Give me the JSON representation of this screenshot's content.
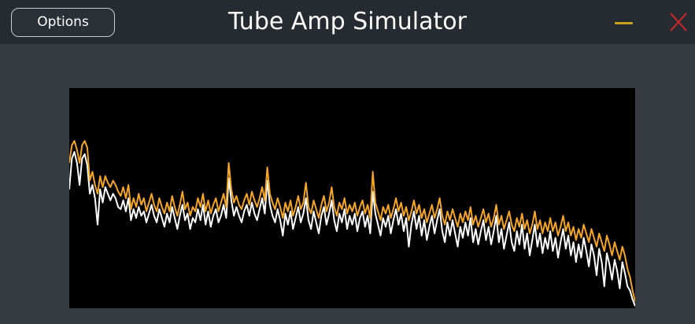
{
  "window": {
    "title": "Tube Amp Simulator",
    "options_label": "Options",
    "minimize_icon": "minimize-icon",
    "close_icon": "close-icon"
  },
  "colors": {
    "background": "#363b42",
    "titlebar": "#262b31",
    "display_background": "#000000",
    "spectrum_primary": "#f5a623",
    "spectrum_secondary": "#ffffff",
    "minimize": "#c9a21d",
    "close": "#c0282d"
  },
  "spectrum": {
    "series": [
      {
        "color": "#f5a623",
        "values": [
          0.66,
          0.74,
          0.76,
          0.72,
          0.66,
          0.74,
          0.76,
          0.73,
          0.58,
          0.62,
          0.56,
          0.52,
          0.6,
          0.55,
          0.6,
          0.57,
          0.55,
          0.58,
          0.56,
          0.53,
          0.51,
          0.55,
          0.5,
          0.56,
          0.45,
          0.5,
          0.46,
          0.52,
          0.47,
          0.5,
          0.44,
          0.48,
          0.52,
          0.47,
          0.44,
          0.5,
          0.46,
          0.43,
          0.48,
          0.44,
          0.51,
          0.46,
          0.42,
          0.47,
          0.53,
          0.45,
          0.48,
          0.42,
          0.46,
          0.44,
          0.5,
          0.46,
          0.52,
          0.44,
          0.49,
          0.43,
          0.47,
          0.5,
          0.44,
          0.48,
          0.52,
          0.46,
          0.66,
          0.54,
          0.48,
          0.51,
          0.47,
          0.45,
          0.49,
          0.52,
          0.47,
          0.53,
          0.49,
          0.46,
          0.5,
          0.55,
          0.49,
          0.64,
          0.52,
          0.48,
          0.45,
          0.5,
          0.46,
          0.41,
          0.48,
          0.44,
          0.49,
          0.42,
          0.46,
          0.51,
          0.45,
          0.48,
          0.57,
          0.46,
          0.43,
          0.49,
          0.45,
          0.41,
          0.47,
          0.51,
          0.44,
          0.48,
          0.55,
          0.46,
          0.42,
          0.48,
          0.45,
          0.5,
          0.43,
          0.47,
          0.44,
          0.48,
          0.42,
          0.46,
          0.49,
          0.43,
          0.47,
          0.41,
          0.62,
          0.48,
          0.44,
          0.4,
          0.46,
          0.43,
          0.47,
          0.41,
          0.45,
          0.5,
          0.44,
          0.48,
          0.42,
          0.46,
          0.4,
          0.44,
          0.49,
          0.43,
          0.47,
          0.41,
          0.45,
          0.39,
          0.43,
          0.47,
          0.41,
          0.45,
          0.5,
          0.42,
          0.38,
          0.44,
          0.4,
          0.45,
          0.41,
          0.37,
          0.43,
          0.39,
          0.44,
          0.4,
          0.46,
          0.38,
          0.42,
          0.37,
          0.41,
          0.45,
          0.39,
          0.43,
          0.37,
          0.41,
          0.47,
          0.38,
          0.42,
          0.36,
          0.4,
          0.44,
          0.38,
          0.35,
          0.41,
          0.37,
          0.43,
          0.36,
          0.4,
          0.34,
          0.38,
          0.44,
          0.36,
          0.4,
          0.34,
          0.39,
          0.35,
          0.41,
          0.35,
          0.39,
          0.33,
          0.37,
          0.42,
          0.35,
          0.39,
          0.33,
          0.37,
          0.31,
          0.36,
          0.32,
          0.38,
          0.34,
          0.3,
          0.36,
          0.32,
          0.28,
          0.34,
          0.3,
          0.26,
          0.33,
          0.29,
          0.24,
          0.3,
          0.26,
          0.22,
          0.28,
          0.24,
          0.18,
          0.14,
          0.08,
          0.03
        ]
      },
      {
        "color": "#ffffff",
        "values": [
          0.54,
          0.68,
          0.71,
          0.66,
          0.56,
          0.68,
          0.7,
          0.65,
          0.52,
          0.56,
          0.5,
          0.38,
          0.54,
          0.48,
          0.55,
          0.52,
          0.49,
          0.52,
          0.5,
          0.46,
          0.45,
          0.49,
          0.44,
          0.5,
          0.4,
          0.45,
          0.41,
          0.46,
          0.42,
          0.44,
          0.39,
          0.43,
          0.47,
          0.42,
          0.39,
          0.45,
          0.41,
          0.37,
          0.43,
          0.39,
          0.46,
          0.41,
          0.36,
          0.42,
          0.47,
          0.4,
          0.43,
          0.36,
          0.41,
          0.39,
          0.45,
          0.4,
          0.47,
          0.38,
          0.44,
          0.37,
          0.42,
          0.45,
          0.39,
          0.42,
          0.47,
          0.41,
          0.59,
          0.49,
          0.42,
          0.46,
          0.42,
          0.39,
          0.44,
          0.47,
          0.42,
          0.48,
          0.43,
          0.4,
          0.45,
          0.5,
          0.43,
          0.58,
          0.47,
          0.42,
          0.39,
          0.45,
          0.4,
          0.33,
          0.43,
          0.38,
          0.44,
          0.36,
          0.41,
          0.46,
          0.39,
          0.43,
          0.5,
          0.4,
          0.36,
          0.44,
          0.39,
          0.34,
          0.42,
          0.46,
          0.38,
          0.43,
          0.49,
          0.4,
          0.35,
          0.43,
          0.39,
          0.45,
          0.36,
          0.42,
          0.38,
          0.43,
          0.35,
          0.41,
          0.44,
          0.37,
          0.42,
          0.34,
          0.53,
          0.43,
          0.38,
          0.33,
          0.41,
          0.37,
          0.42,
          0.34,
          0.4,
          0.45,
          0.38,
          0.43,
          0.35,
          0.41,
          0.28,
          0.38,
          0.44,
          0.36,
          0.42,
          0.33,
          0.4,
          0.31,
          0.37,
          0.42,
          0.34,
          0.4,
          0.45,
          0.35,
          0.3,
          0.39,
          0.33,
          0.4,
          0.34,
          0.28,
          0.37,
          0.32,
          0.39,
          0.33,
          0.41,
          0.3,
          0.36,
          0.29,
          0.35,
          0.4,
          0.31,
          0.37,
          0.29,
          0.35,
          0.42,
          0.3,
          0.36,
          0.27,
          0.33,
          0.39,
          0.3,
          0.26,
          0.35,
          0.29,
          0.38,
          0.27,
          0.34,
          0.24,
          0.31,
          0.38,
          0.28,
          0.34,
          0.25,
          0.32,
          0.27,
          0.35,
          0.26,
          0.32,
          0.23,
          0.3,
          0.36,
          0.27,
          0.33,
          0.24,
          0.3,
          0.21,
          0.29,
          0.23,
          0.32,
          0.26,
          0.19,
          0.29,
          0.24,
          0.15,
          0.27,
          0.21,
          0.1,
          0.25,
          0.2,
          0.13,
          0.22,
          0.17,
          0.09,
          0.21,
          0.16,
          0.1,
          0.08,
          0.04,
          0.01
        ]
      }
    ]
  }
}
